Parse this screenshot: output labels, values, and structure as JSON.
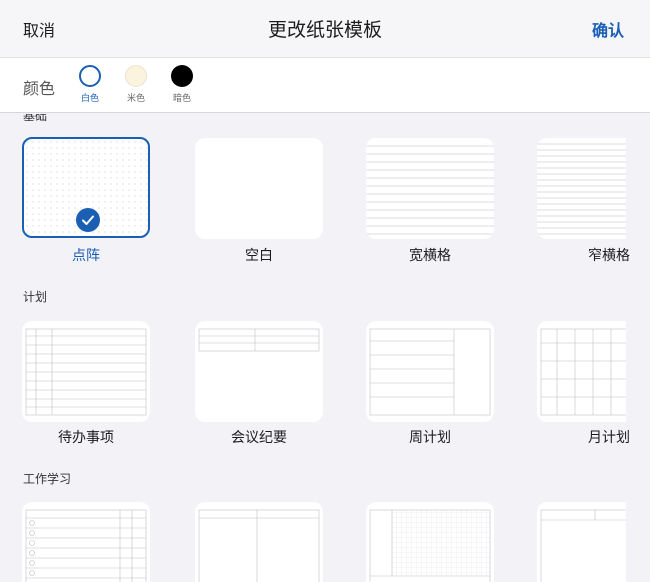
{
  "header": {
    "cancel": "取消",
    "title": "更改纸张模板",
    "confirm": "确认"
  },
  "colors": {
    "label": "颜色",
    "options": [
      {
        "name": "白色",
        "swatch": "#ffffff",
        "selected": true
      },
      {
        "name": "米色",
        "swatch": "#fbf3de",
        "selected": false
      },
      {
        "name": "暗色",
        "swatch": "#000000",
        "selected": false
      }
    ],
    "accent": "#1a5fb4"
  },
  "sections": [
    {
      "title": "基础",
      "templates": [
        {
          "label": "点阵",
          "selected": true
        },
        {
          "label": "空白"
        },
        {
          "label": "宽横格"
        },
        {
          "label": "窄横格"
        }
      ]
    },
    {
      "title": "计划",
      "templates": [
        {
          "label": "待办事项"
        },
        {
          "label": "会议纪要"
        },
        {
          "label": "周计划"
        },
        {
          "label": "月计划"
        }
      ]
    },
    {
      "title": "工作学习",
      "templates": [
        {
          "label": ""
        },
        {
          "label": ""
        },
        {
          "label": ""
        },
        {
          "label": ""
        }
      ]
    }
  ]
}
